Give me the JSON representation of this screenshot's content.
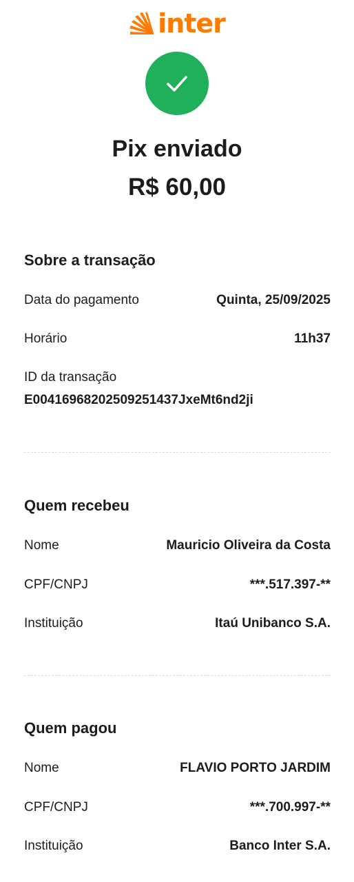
{
  "brand": {
    "name": "inter",
    "color": "#ff7a00"
  },
  "status": {
    "icon": "check-icon",
    "color": "#20b05a"
  },
  "header": {
    "title": "Pix enviado",
    "amount": "R$ 60,00"
  },
  "transaction": {
    "section_title": "Sobre a transação",
    "date_label": "Data do pagamento",
    "date_value": "Quinta, 25/09/2025",
    "time_label": "Horário",
    "time_value": "11h37",
    "id_label": "ID da transação",
    "id_value": "E00416968202509251437JxeMt6nd2ji"
  },
  "receiver": {
    "section_title": "Quem recebeu",
    "name_label": "Nome",
    "name_value": "Mauricio Oliveira da Costa",
    "doc_label": "CPF/CNPJ",
    "doc_value": "***.517.397-**",
    "bank_label": "Instituição",
    "bank_value": "Itaú Unibanco S.A."
  },
  "payer": {
    "section_title": "Quem pagou",
    "name_label": "Nome",
    "name_value": "FLAVIO PORTO JARDIM",
    "doc_label": "CPF/CNPJ",
    "doc_value": "***.700.997-**",
    "bank_label": "Instituição",
    "bank_value": "Banco Inter S.A."
  }
}
